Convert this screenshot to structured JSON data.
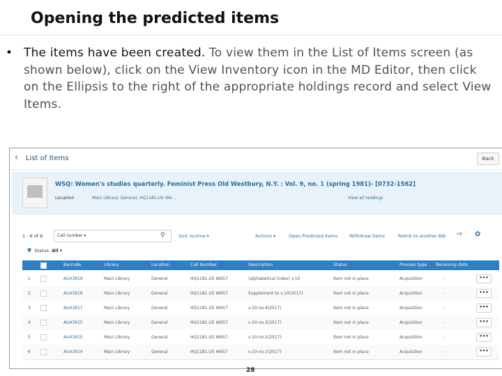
{
  "slide": {
    "title": "Opening the predicted items",
    "bullet": "•",
    "text_dark": "The items have been created.",
    "text_light": " To view them in the List of Items screen (as shown below), click on the View Inventory icon in the MD Editor, then click on the Ellipsis to the right of the appropriate holdings record and select View Items.",
    "page_number": "28"
  },
  "screen": {
    "header": {
      "back_arrow": "‹",
      "title": "List of Items",
      "back_button": "Back"
    },
    "record": {
      "title": "WSQ: Women's studies quarterly. Feminist Press Old Westbury, N.Y. : Vol. 9, no. 1 (spring 1981)- [0732-1562]",
      "location_label": "Location",
      "location_value": "Main Library: General, HQ1181.U5 W6...",
      "view_all_holdings": "View all holdings"
    },
    "toolbar": {
      "count": "1 - 6 of 6",
      "search_scope": "Call number",
      "search_scope_arrow": "▾",
      "search_icon": "⚲",
      "sort": "Sort routine ▾",
      "actions": "Actions ▾",
      "open_predicted": "Open Predicted Items",
      "withdraw": "Withdraw items",
      "relink": "Relink to another Bib",
      "export_icon": "⇨",
      "settings_icon": "✿"
    },
    "filter": {
      "icon": "▼",
      "label": "Status",
      "value": "All ▾"
    },
    "columns": [
      "Barcode",
      "Library",
      "Location",
      "Call Number",
      "Description",
      "Status",
      "Process type",
      "Receiving date"
    ],
    "rows": [
      {
        "n": "1",
        "barcode": "AU43919",
        "library": "Main Library",
        "location": "General",
        "call": "HQ1181.U5 W657",
        "desc": "(alphabetical index) v.10",
        "status": "Item not in place",
        "process": "Acquisition",
        "date": "-",
        "more": "•••"
      },
      {
        "n": "2",
        "barcode": "AU43918",
        "library": "Main Library",
        "location": "General",
        "call": "HQ1181.U5 W657",
        "desc": "Supplement to v.10(2017)",
        "status": "Item not in place",
        "process": "Acquisition",
        "date": "-",
        "more": "•••"
      },
      {
        "n": "3",
        "barcode": "AU43917",
        "library": "Main Library",
        "location": "General",
        "call": "HQ1181.U5 W657",
        "desc": "v.10:no.4(2017)",
        "status": "Item not in place",
        "process": "Acquisition",
        "date": "-",
        "more": "•••"
      },
      {
        "n": "4",
        "barcode": "AU43915",
        "library": "Main Library",
        "location": "General",
        "call": "HQ1181.U5 W657",
        "desc": "v.10:no.3(2017)",
        "status": "Item not in place",
        "process": "Acquisition",
        "date": "-",
        "more": "•••"
      },
      {
        "n": "5",
        "barcode": "AU43915",
        "library": "Main Library",
        "location": "General",
        "call": "HQ1181.U5 W657",
        "desc": "v.10:no.2(2017)",
        "status": "Item not in place",
        "process": "Acquisition",
        "date": "-",
        "more": "•••"
      },
      {
        "n": "6",
        "barcode": "AU43914",
        "library": "Main Library",
        "location": "General",
        "call": "HQ1181.U5 W657",
        "desc": "v.10:no.1(2017)",
        "status": "Item not in place",
        "process": "Acquisition",
        "date": "-",
        "more": "•••"
      }
    ],
    "colors": {
      "accent": "#2e7fc4",
      "link": "#2a6d9e",
      "record_bg": "#e9f2f8",
      "text_light": "#505050"
    }
  }
}
